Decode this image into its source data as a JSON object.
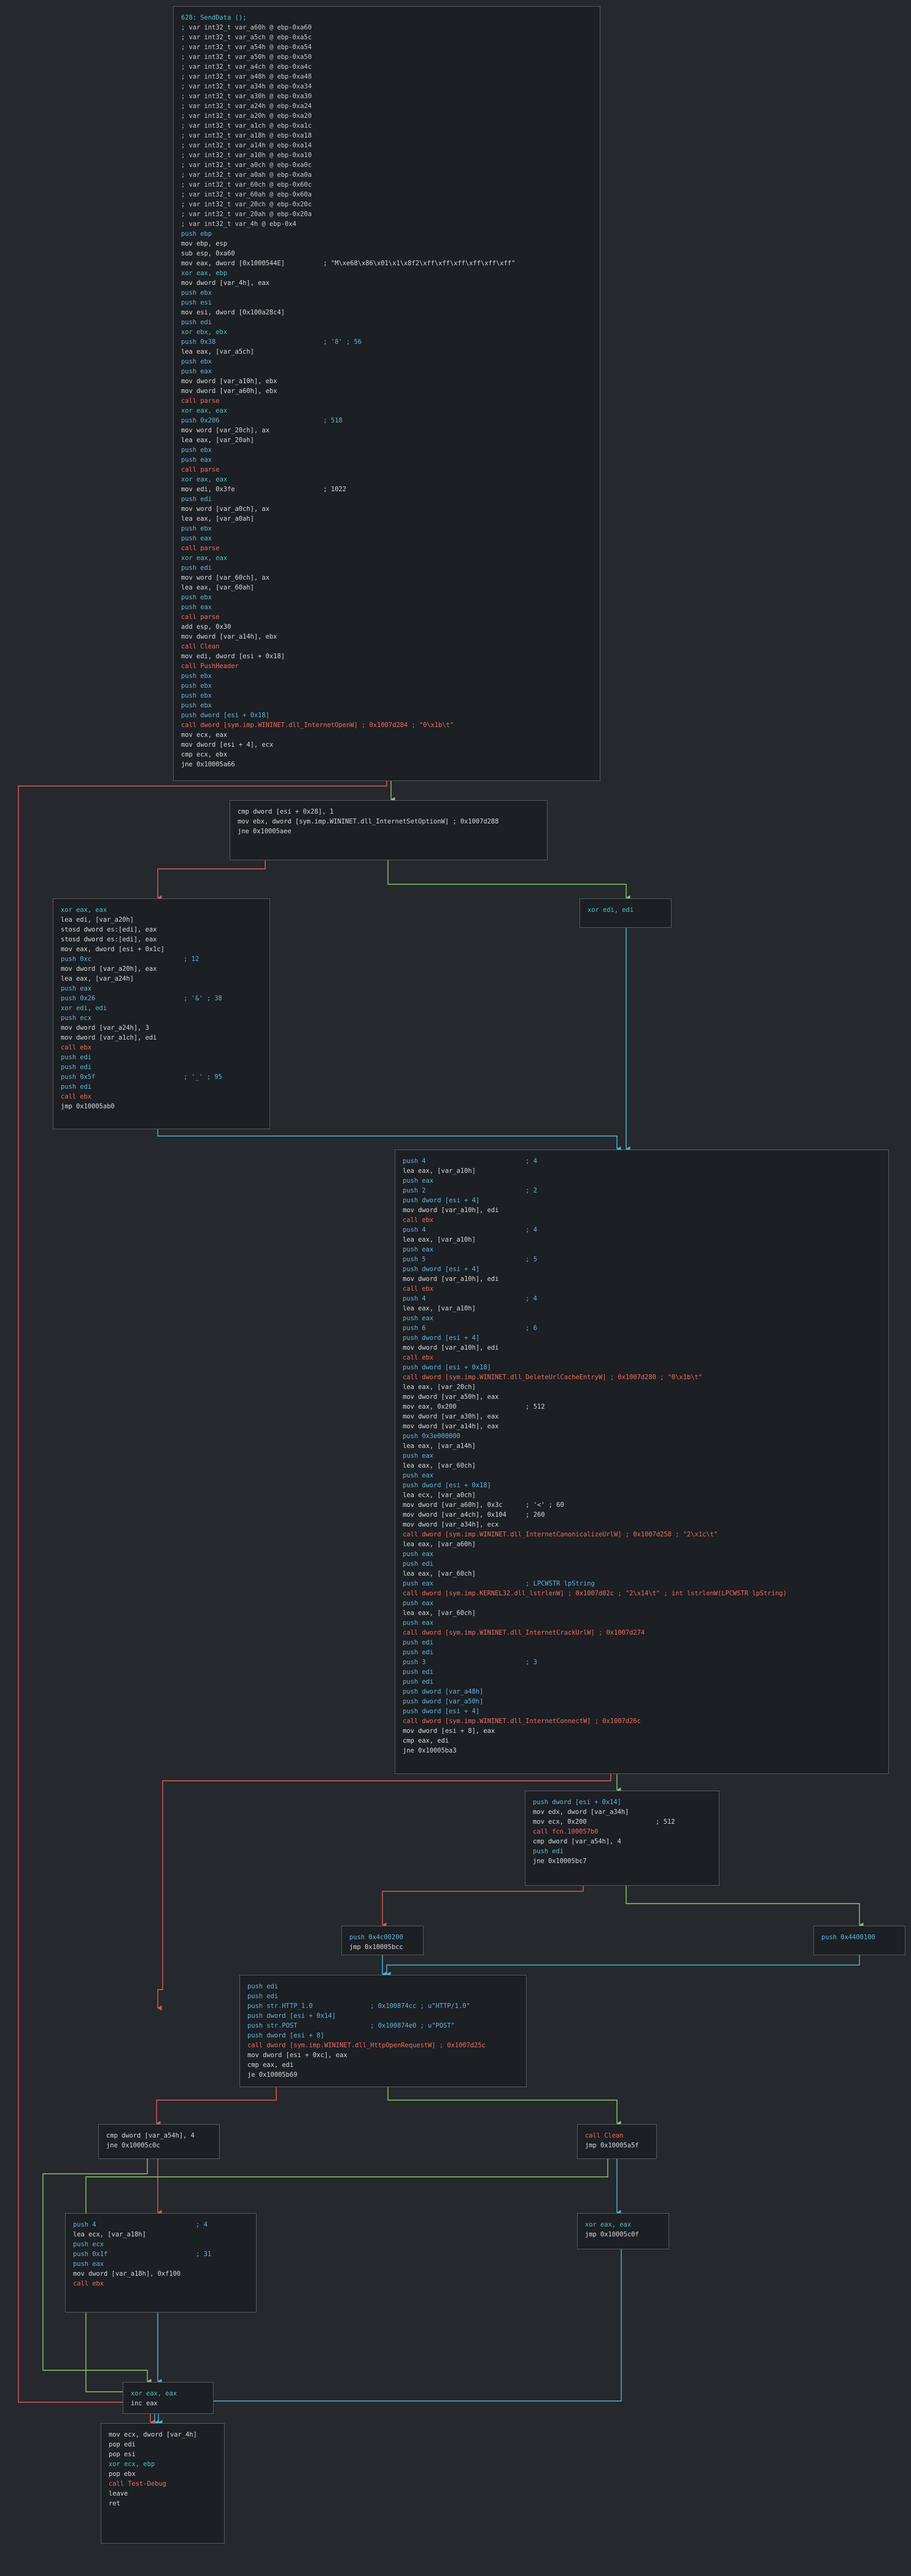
{
  "colors": {
    "background": "#25282c",
    "block_fill": "#1c1f23",
    "block_border": "#565b61",
    "edge_true": "#8fc46a",
    "edge_false": "#e05a5a",
    "edge_uncond": "#4fb3d9",
    "text": "#d6d9dc",
    "number": "#e58a54",
    "call": "#ef6c5f",
    "label": "#55c1d7"
  },
  "blocks": [
    {
      "id": "b0",
      "lines": [
        "628: SendData ();",
        "; var int32_t var_a60h @ ebp-0xa60",
        "; var int32_t var_a5ch @ ebp-0xa5c",
        "; var int32_t var_a54h @ ebp-0xa54",
        "; var int32_t var_a50h @ ebp-0xa50",
        "; var int32_t var_a4ch @ ebp-0xa4c",
        "; var int32_t var_a48h @ ebp-0xa48",
        "; var int32_t var_a34h @ ebp-0xa34",
        "; var int32_t var_a30h @ ebp-0xa30",
        "; var int32_t var_a24h @ ebp-0xa24",
        "; var int32_t var_a20h @ ebp-0xa20",
        "; var int32_t var_a1ch @ ebp-0xa1c",
        "; var int32_t var_a18h @ ebp-0xa18",
        "; var int32_t var_a14h @ ebp-0xa14",
        "; var int32_t var_a10h @ ebp-0xa10",
        "; var int32_t var_a0ch @ ebp-0xa0c",
        "; var int32_t var_a0ah @ ebp-0xa0a",
        "; var int32_t var_60ch @ ebp-0x60c",
        "; var int32_t var_60ah @ ebp-0x60a",
        "; var int32_t var_20ch @ ebp-0x20c",
        "; var int32_t var_20ah @ ebp-0x20a",
        "; var int32_t var_4h @ ebp-0x4",
        "push ebp",
        "mov ebp, esp",
        "sub esp, 0xa60",
        "mov eax, dword [0x1000544E]          ; \"M\\xe68\\x86\\x01\\x1\\x8f2\\xff\\xff\\xff\\xff\\xff\\xff\"",
        "xor eax, ebp",
        "mov dword [var_4h], eax",
        "push ebx",
        "push esi",
        "mov esi, dword [0x100a28c4]",
        "push edi",
        "xor ebx, ebx",
        "push 0x38                            ; '8' ; 56",
        "lea eax, [var_a5ch]",
        "push ebx",
        "push eax",
        "mov dword [var_a10h], ebx",
        "mov dword [var_a60h], ebx",
        "call parse",
        "xor eax, eax",
        "push 0x206                           ; 518",
        "mov word [var_20ch], ax",
        "lea eax, [var_20ah]",
        "push ebx",
        "push eax",
        "call parse",
        "xor eax, eax",
        "mov edi, 0x3fe                       ; 1022",
        "push edi",
        "mov word [var_a0ch], ax",
        "lea eax, [var_a0ah]",
        "push ebx",
        "push eax",
        "call parse",
        "xor eax, eax",
        "push edi",
        "mov word [var_60ch], ax",
        "lea eax, [var_60ah]",
        "push ebx",
        "push eax",
        "call parse",
        "add esp, 0x30",
        "mov dword [var_a14h], ebx",
        "call Clean",
        "mov edi, dword [esi + 0x18]",
        "call PushHeader",
        "push ebx",
        "push ebx",
        "push ebx",
        "push ebx",
        "push dword [esi + 0x18]",
        "call dword [sym.imp.WININET.dll_InternetOpenW] ; 0x1007d284 ; \"0\\x1b\\t\"",
        "mov ecx, eax",
        "mov dword [esi + 4], ecx",
        "cmp ecx, ebx",
        "jne 0x10005a66"
      ]
    },
    {
      "id": "b1",
      "lines": [
        "cmp dword [esi + 0x28], 1",
        "mov ebx, dword [sym.imp.WININET.dll_InternetSetOptionW] ; 0x1007d288",
        "jne 0x10005aee"
      ]
    },
    {
      "id": "b2",
      "lines": [
        "xor eax, eax",
        "lea edi, [var_a20h]",
        "stosd dword es:[edi], eax",
        "stosd dword es:[edi], eax",
        "mov eax, dword [esi + 0x1c]",
        "push 0xc                        ; 12",
        "mov dword [var_a20h], eax",
        "lea eax, [var_a24h]",
        "push eax",
        "push 0x26                       ; '&' ; 38",
        "xor edi, edi",
        "push ecx",
        "mov dword [var_a24h], 3",
        "mov dword [var_a1ch], edi",
        "call ebx",
        "push edi",
        "push edi",
        "push 0x5f                       ; '_' ; 95",
        "push edi",
        "call ebx",
        "jmp 0x10005ab0"
      ]
    },
    {
      "id": "b3",
      "lines": [
        "xor edi, edi"
      ]
    },
    {
      "id": "b4",
      "lines": [
        "push 4                          ; 4",
        "lea eax, [var_a10h]",
        "push eax",
        "push 2                          ; 2",
        "push dword [esi + 4]",
        "mov dword [var_a10h], edi",
        "call ebx",
        "push 4                          ; 4",
        "lea eax, [var_a10h]",
        "push eax",
        "push 5                          ; 5",
        "push dword [esi + 4]",
        "mov dword [var_a10h], edi",
        "call ebx",
        "push 4                          ; 4",
        "lea eax, [var_a10h]",
        "push eax",
        "push 6                          ; 6",
        "push dword [esi + 4]",
        "mov dword [var_a10h], edi",
        "call ebx",
        "push dword [esi + 0x18]",
        "call dword [sym.imp.WININET.dll_DeleteUrlCacheEntryW] ; 0x1007d280 ; \"0\\x1b\\t\"",
        "lea eax, [var_20ch]",
        "mov dword [var_a50h], eax",
        "mov eax, 0x200                  ; 512",
        "mov dword [var_a30h], eax",
        "mov dword [var_a14h], eax",
        "push 0x3e000000",
        "lea eax, [var_a14h]",
        "push eax",
        "lea eax, [var_60ch]",
        "push eax",
        "push dword [esi + 0x18]",
        "lea ecx, [var_a0ch]",
        "mov dword [var_a60h], 0x3c      ; '<' ; 60",
        "mov dword [var_a4ch], 0x104     ; 260",
        "mov dword [var_a34h], ecx",
        "call dword [sym.imp.WININET.dll_InternetCanonicalizeUrlW] ; 0x1007d258 ; \"2\\x1c\\t\"",
        "lea eax, [var_a60h]",
        "push eax",
        "push edi",
        "lea eax, [var_60ch]",
        "push eax                        ; LPCWSTR lpString",
        "call dword [sym.imp.KERNEL32.dll_lstrlenW] ; 0x1007d02c ; \"2\\x14\\t\" ; int lstrlenW(LPCWSTR lpString)",
        "push eax",
        "lea eax, [var_60ch]",
        "push eax",
        "call dword [sym.imp.WININET.dll_InternetCrackUrlW] ; 0x1007d274",
        "push edi",
        "push edi",
        "push 3                          ; 3",
        "push edi",
        "push edi",
        "push dword [var_a48h]",
        "push dword [var_a50h]",
        "push dword [esi + 4]",
        "call dword [sym.imp.WININET.dll_InternetConnectW] ; 0x1007d26c",
        "mov dword [esi + 8], eax",
        "cmp eax, edi",
        "jne 0x10005ba3"
      ]
    },
    {
      "id": "b5",
      "lines": [
        "push dword [esi + 0x14]",
        "mov edx, dword [var_a34h]",
        "mov ecx, 0x200                  ; 512",
        "call fcn.100057b0",
        "cmp dword [var_a54h], 4",
        "push edi",
        "jne 0x10005bc7"
      ]
    },
    {
      "id": "b6",
      "lines": [
        "push 0x4c00200",
        "jmp 0x10005bcc"
      ]
    },
    {
      "id": "b7",
      "lines": [
        "push 0x4400100"
      ]
    },
    {
      "id": "b8",
      "lines": [
        "push edi",
        "push edi",
        "push str.HTTP_1.0               ; 0x100874cc ; u\"HTTP/1.0\"",
        "push dword [esi + 0x14]",
        "push str.POST                   ; 0x100874e0 ; u\"POST\"",
        "push dword [esi + 8]",
        "call dword [sym.imp.WININET.dll_HttpOpenRequestW] ; 0x1007d25c",
        "mov dword [esi + 0xc], eax",
        "cmp eax, edi",
        "je 0x10005b69"
      ]
    },
    {
      "id": "b9",
      "lines": [
        "cmp dword [var_a54h], 4",
        "jne 0x10005c0c"
      ]
    },
    {
      "id": "b10",
      "lines": [
        "call Clean",
        "jmp 0x10005a5f"
      ]
    },
    {
      "id": "b11",
      "lines": [
        "push 4                          ; 4",
        "lea ecx, [var_a18h]",
        "push ecx",
        "push 0x1f                       ; 31",
        "push eax",
        "mov dword [var_a18h], 0xf100",
        "call ebx"
      ]
    },
    {
      "id": "b12",
      "lines": [
        "xor eax, eax",
        "jmp 0x10005c0f"
      ]
    },
    {
      "id": "b13",
      "lines": [
        "xor eax, eax",
        "inc eax"
      ]
    },
    {
      "id": "b14",
      "lines": [
        "mov ecx, dword [var_4h]",
        "pop edi",
        "pop esi",
        "xor ecx, ebp",
        "pop ebx",
        "call Test-Debug",
        "leave",
        "ret"
      ]
    }
  ]
}
